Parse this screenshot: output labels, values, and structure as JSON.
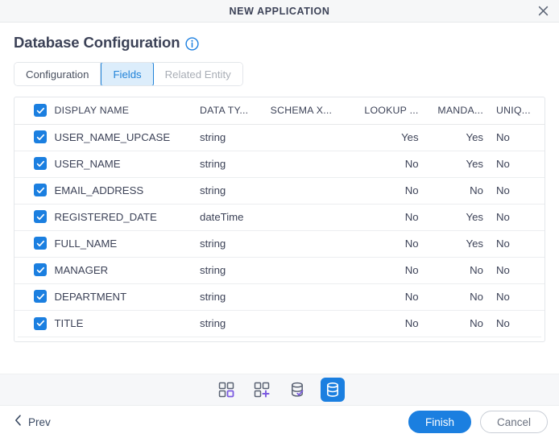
{
  "window": {
    "title": "NEW APPLICATION",
    "close_icon": "close-icon"
  },
  "page": {
    "heading": "Database Configuration",
    "info_icon": "info-circle-icon"
  },
  "tabs": [
    {
      "label": "Configuration",
      "state": "normal"
    },
    {
      "label": "Fields",
      "state": "active"
    },
    {
      "label": "Related Entity",
      "state": "disabled"
    }
  ],
  "table": {
    "select_all_checked": true,
    "columns": [
      {
        "key": "check",
        "label": ""
      },
      {
        "key": "name",
        "label": "DISPLAY NAME"
      },
      {
        "key": "type",
        "label": "DATA TY..."
      },
      {
        "key": "schema",
        "label": "SCHEMA X..."
      },
      {
        "key": "lookup",
        "label": "LOOKUP ..."
      },
      {
        "key": "mand",
        "label": "MANDA..."
      },
      {
        "key": "uniq",
        "label": "UNIQ..."
      }
    ],
    "rows": [
      {
        "checked": true,
        "name": "USER_NAME_UPCASE",
        "type": "string",
        "schema": "",
        "lookup": "Yes",
        "mand": "Yes",
        "uniq": "No"
      },
      {
        "checked": true,
        "name": "USER_NAME",
        "type": "string",
        "schema": "",
        "lookup": "No",
        "mand": "Yes",
        "uniq": "No"
      },
      {
        "checked": true,
        "name": "EMAIL_ADDRESS",
        "type": "string",
        "schema": "",
        "lookup": "No",
        "mand": "No",
        "uniq": "No"
      },
      {
        "checked": true,
        "name": "REGISTERED_DATE",
        "type": "dateTime",
        "schema": "",
        "lookup": "No",
        "mand": "Yes",
        "uniq": "No"
      },
      {
        "checked": true,
        "name": "FULL_NAME",
        "type": "string",
        "schema": "",
        "lookup": "No",
        "mand": "Yes",
        "uniq": "No"
      },
      {
        "checked": true,
        "name": "MANAGER",
        "type": "string",
        "schema": "",
        "lookup": "No",
        "mand": "No",
        "uniq": "No"
      },
      {
        "checked": true,
        "name": "DEPARTMENT",
        "type": "string",
        "schema": "",
        "lookup": "No",
        "mand": "No",
        "uniq": "No"
      },
      {
        "checked": true,
        "name": "TITLE",
        "type": "string",
        "schema": "",
        "lookup": "No",
        "mand": "No",
        "uniq": "No"
      }
    ]
  },
  "step_icons": [
    {
      "name": "grid-squares-icon",
      "active": false
    },
    {
      "name": "grid-add-icon",
      "active": false
    },
    {
      "name": "database-check-icon",
      "active": false
    },
    {
      "name": "database-icon",
      "active": true
    }
  ],
  "footer": {
    "prev_label": "Prev",
    "prev_icon": "chevron-left-icon",
    "finish_label": "Finish",
    "cancel_label": "Cancel"
  },
  "colors": {
    "accent": "#1b7fe0",
    "accent_soft": "#dcedfb",
    "purple": "#7b59e0",
    "text": "#3c4257",
    "muted": "#a9aeb6",
    "titlebar_bg": "#f6f7f8",
    "strip_bg": "#f6f7f9",
    "border": "#e3e6ea"
  }
}
